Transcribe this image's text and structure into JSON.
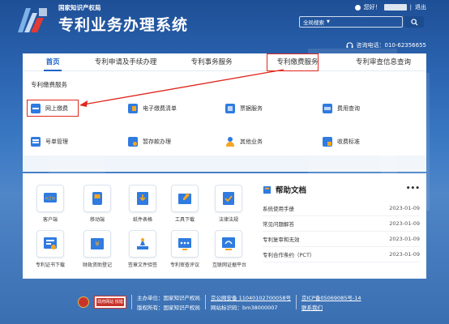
{
  "header": {
    "org_name": "国家知识产权局",
    "system_title": "专利业务办理系统",
    "greeting": "您好！",
    "username": "",
    "logout": "退出",
    "search_placeholder": "全局搜索",
    "phone_label": "咨询电话：010-62356655"
  },
  "nav": {
    "items": [
      {
        "label": "首页"
      },
      {
        "label": "专利申请及手续办理"
      },
      {
        "label": "专利事务服务"
      },
      {
        "label": "专利缴费服务"
      },
      {
        "label": "专利审查信息查询"
      }
    ]
  },
  "dropdown": {
    "title": "专利缴费服务",
    "items": [
      {
        "label": "网上缴费",
        "icon": "online-pay-icon"
      },
      {
        "label": "电子缴费清单",
        "icon": "payment-list-icon"
      },
      {
        "label": "票据服务",
        "icon": "invoice-icon"
      },
      {
        "label": "费用查询",
        "icon": "fee-query-icon"
      },
      {
        "label": "号单管理",
        "icon": "number-manage-icon"
      },
      {
        "label": "暂存款办理",
        "icon": "deposit-icon"
      },
      {
        "label": "其他业务",
        "icon": "other-business-icon"
      },
      {
        "label": "收费标准",
        "icon": "fee-standard-icon"
      }
    ]
  },
  "services": [
    {
      "label": "客户端"
    },
    {
      "label": "移动端"
    },
    {
      "label": "纸件表格"
    },
    {
      "label": "工具下载"
    },
    {
      "label": "法律法规"
    },
    {
      "label": "专利证书下载"
    },
    {
      "label": "财政资助登记"
    },
    {
      "label": "签章文件验签"
    },
    {
      "label": "专利审查评议"
    },
    {
      "label": "互联网证据平台"
    }
  ],
  "help": {
    "title": "帮助文档",
    "more": "•••",
    "docs": [
      {
        "title": "系统使用手册",
        "date": "2023-01-09"
      },
      {
        "title": "常见问题解答",
        "date": "2023-01-09"
      },
      {
        "title": "专利复审和无效",
        "date": "2023-01-09"
      },
      {
        "title": "专利合作条约（PCT）",
        "date": "2023-01-09"
      }
    ]
  },
  "footer": {
    "badge": "政府网站 找错",
    "sponsor": "主办单位：国家知识产权局",
    "copyright": "版权所有：国家知识产权局",
    "police": "京公网安备 11040102700058号",
    "site_id": "网站标识码：bm38000007",
    "icp": "京ICP备05069085号-14",
    "contact": "联系我们"
  },
  "colors": {
    "accent": "#1b63c9",
    "highlight": "#e0261d",
    "bg": "#2b5d9e"
  }
}
